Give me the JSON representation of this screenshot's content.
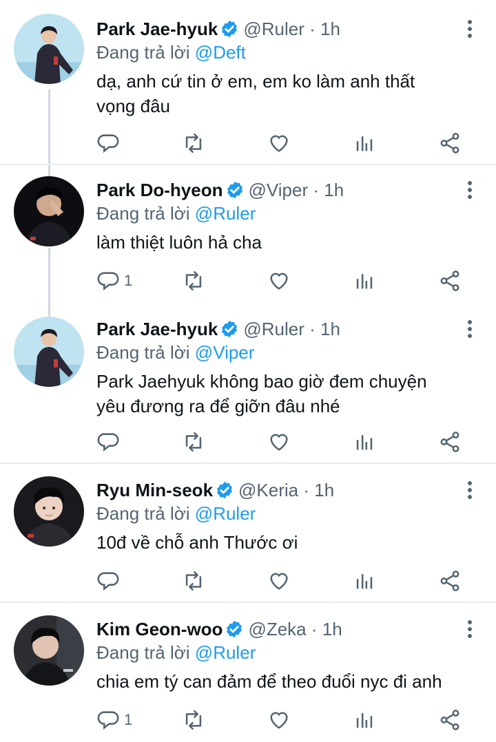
{
  "tweets": [
    {
      "name": "Park Jae-hyuk",
      "handle": "@Ruler",
      "separator": "·",
      "time": "1h",
      "replying_prefix": "Đang trả lời",
      "replying_to": "@Deft",
      "lines": [
        "dạ, anh cứ tin ở em, em ko làm anh thất",
        "vọng đâu"
      ],
      "reply_count": ""
    },
    {
      "name": "Park Do-hyeon",
      "handle": "@Viper",
      "separator": "·",
      "time": "1h",
      "replying_prefix": "Đang trả lời",
      "replying_to": "@Ruler",
      "lines": [
        "làm thiệt luôn hả cha"
      ],
      "reply_count": "1"
    },
    {
      "name": "Park Jae-hyuk",
      "handle": "@Ruler",
      "separator": "·",
      "time": "1h",
      "replying_prefix": "Đang trả lời",
      "replying_to": "@Viper",
      "lines": [
        "Park Jaehyuk không bao giờ đem chuyện",
        "yêu đương ra để giỡn đâu nhé"
      ],
      "reply_count": ""
    },
    {
      "name": "Ryu Min-seok",
      "handle": "@Keria",
      "separator": "·",
      "time": "1h",
      "replying_prefix": "Đang trả lời",
      "replying_to": "@Ruler",
      "lines": [
        "10đ về chỗ anh Thước ơi"
      ],
      "reply_count": ""
    },
    {
      "name": "Kim Geon-woo",
      "handle": "@Zeka",
      "separator": "·",
      "time": "1h",
      "replying_prefix": "Đang trả lời",
      "replying_to": "@Ruler",
      "lines": [
        "chia em tý can đảm để theo đuổi nyc đi anh"
      ],
      "reply_count": "1"
    }
  ],
  "icons": {
    "verified": "verified-badge-icon",
    "more": "more-vertical-icon",
    "reply": "reply-icon",
    "retweet": "retweet-icon",
    "like": "like-icon",
    "views": "views-icon",
    "share": "share-icon"
  },
  "colors": {
    "accent": "#1d9bf0",
    "text": "#0f1419",
    "secondary": "#536471",
    "thread_line": "#cfd9de"
  }
}
